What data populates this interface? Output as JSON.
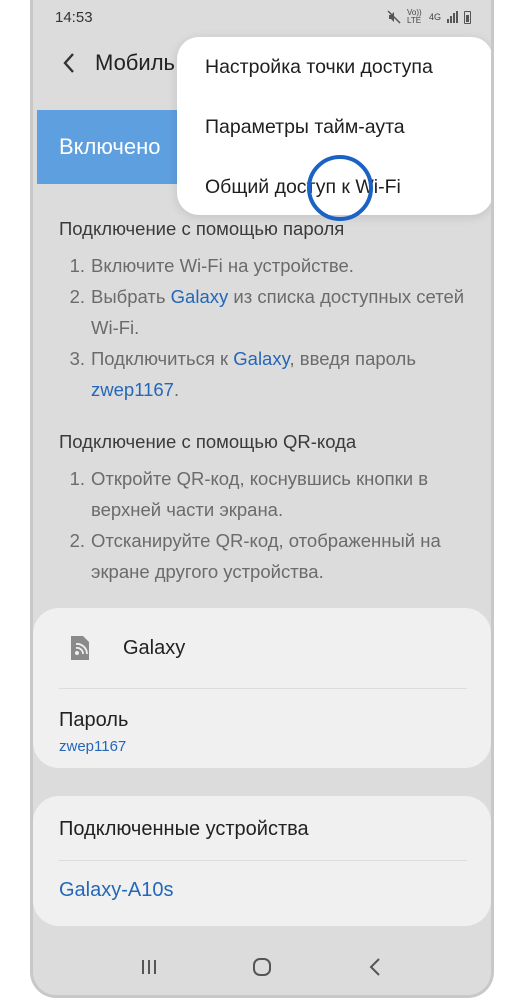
{
  "status_bar": {
    "time": "14:53",
    "net1": "Vo)) LTE",
    "net2": "4G"
  },
  "header": {
    "title": "Мобиль"
  },
  "toggle": {
    "label": "Включено"
  },
  "password_section": {
    "heading": "Подключение с помощью пароля",
    "steps": [
      {
        "num": "1.",
        "text": "Включите Wi-Fi на устройстве."
      },
      {
        "num": "2.",
        "pre": "Выбрать ",
        "link": "Galaxy",
        "post": " из списка доступных сетей Wi-Fi."
      },
      {
        "num": "3.",
        "pre": "Подключиться к ",
        "link": "Galaxy",
        "mid": ", введя пароль ",
        "link2": "zwep1167",
        "post": "."
      }
    ]
  },
  "qr_section": {
    "heading": "Подключение с помощью QR-кода",
    "steps": [
      {
        "num": "1.",
        "text": "Откройте QR-код, коснувшись кнопки в верхней части экрана."
      },
      {
        "num": "2.",
        "text": "Отсканируйте QR-код, отображенный на экране другого устройства."
      }
    ]
  },
  "hotspot_card": {
    "name": "Galaxy",
    "password_label": "Пароль",
    "password_value": "zwep1167"
  },
  "devices_card": {
    "heading": "Подключенные устройства",
    "device": "Galaxy-A10s"
  },
  "menu": {
    "items": [
      "Настройка точки доступа",
      "Параметры тайм-аута",
      "Общий доступ к Wi-Fi"
    ]
  },
  "colors": {
    "accent": "#5e9fe0",
    "link": "#2467b8",
    "tap_circle": "#1a63c4"
  }
}
